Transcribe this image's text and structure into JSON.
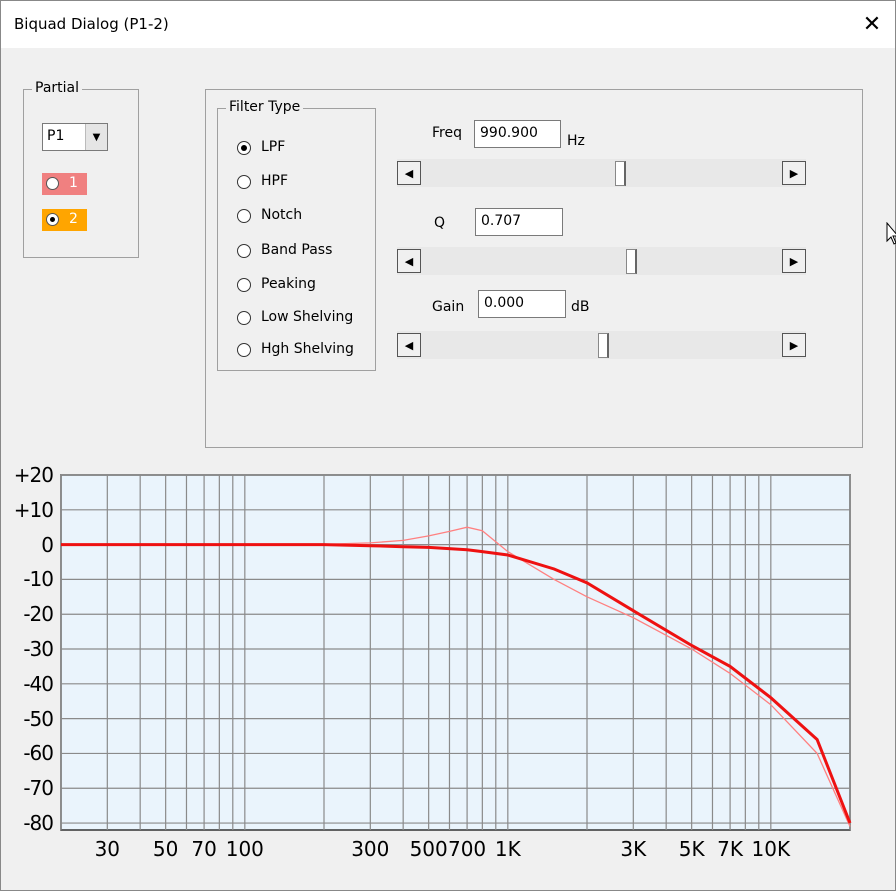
{
  "window": {
    "title": "Biquad Dialog (P1-2)",
    "close_glyph": "✕"
  },
  "partial": {
    "legend": "Partial",
    "selected": "P1",
    "buttons": [
      {
        "label": "1",
        "color": "#f08080",
        "selected": false
      },
      {
        "label": "2",
        "color": "#ffa500",
        "selected": true
      }
    ]
  },
  "filter_type": {
    "legend": "Filter Type",
    "options": [
      {
        "label": "LPF",
        "selected": true
      },
      {
        "label": "HPF",
        "selected": false
      },
      {
        "label": "Notch",
        "selected": false
      },
      {
        "label": "Band Pass",
        "selected": false
      },
      {
        "label": "Peaking",
        "selected": false
      },
      {
        "label": "Low Shelving",
        "selected": false
      },
      {
        "label": "Hgh Shelving",
        "selected": false
      }
    ]
  },
  "params": {
    "freq": {
      "label": "Freq",
      "value": "990.900",
      "unit": "Hz",
      "slider": 0.55
    },
    "q": {
      "label": "Q",
      "value": "0.707",
      "slider": 0.58
    },
    "gain": {
      "label": "Gain",
      "value": "0.000",
      "unit": "dB",
      "slider": 0.5
    }
  },
  "chart_data": {
    "type": "line",
    "x_scale": "log",
    "xlim": [
      20,
      20000
    ],
    "ylim": [
      -82,
      20
    ],
    "y_ticks": [
      "+20",
      "+10",
      "0",
      "-10",
      "-20",
      "-30",
      "-40",
      "-50",
      "-60",
      "-70",
      "-80"
    ],
    "x_ticks": [
      {
        "value": 30,
        "label": "30"
      },
      {
        "value": 50,
        "label": "50"
      },
      {
        "value": 70,
        "label": "70"
      },
      {
        "value": 100,
        "label": "100"
      },
      {
        "value": 300,
        "label": "300"
      },
      {
        "value": 500,
        "label": "500"
      },
      {
        "value": 700,
        "label": "700"
      },
      {
        "value": 1000,
        "label": "1K"
      },
      {
        "value": 3000,
        "label": "3K"
      },
      {
        "value": 5000,
        "label": "5K"
      },
      {
        "value": 7000,
        "label": "7K"
      },
      {
        "value": 10000,
        "label": "10K"
      }
    ],
    "grid_x": [
      20,
      30,
      40,
      50,
      60,
      70,
      80,
      90,
      100,
      200,
      300,
      400,
      500,
      600,
      700,
      800,
      900,
      1000,
      2000,
      3000,
      4000,
      5000,
      6000,
      7000,
      8000,
      9000,
      10000,
      20000
    ],
    "grid": true,
    "plot_bg": "#eaf4fc",
    "series": [
      {
        "color": "#ff8080",
        "x": [
          20,
          100,
          200,
          300,
          400,
          500,
          600,
          700,
          800,
          1000,
          1500,
          2000,
          3000,
          5000,
          7000,
          10000,
          15000,
          20000
        ],
        "y": [
          0,
          0,
          0.1,
          0.5,
          1.2,
          2.5,
          3.8,
          5,
          4,
          -2,
          -10,
          -15,
          -21,
          -30,
          -37,
          -46,
          -60,
          -81
        ]
      },
      {
        "color": "#ee1111",
        "x": [
          20,
          100,
          200,
          300,
          400,
          500,
          700,
          800,
          1000,
          1500,
          2000,
          3000,
          5000,
          7000,
          10000,
          15000,
          20000
        ],
        "y": [
          0,
          0,
          0,
          -0.3,
          -0.6,
          -0.8,
          -1.5,
          -2,
          -3,
          -7,
          -11,
          -19,
          -29,
          -35,
          -44,
          -56,
          -80
        ]
      }
    ]
  }
}
